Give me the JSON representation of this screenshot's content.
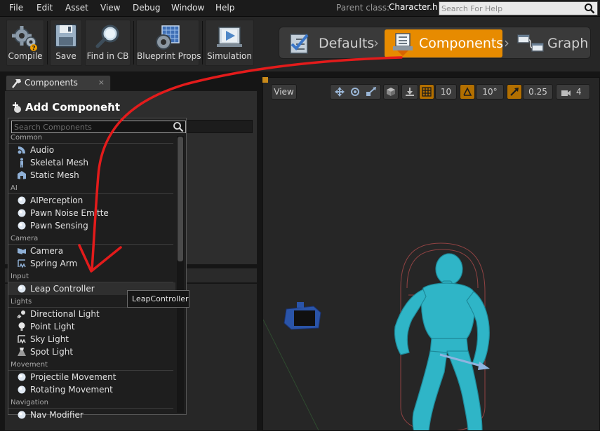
{
  "menu": [
    "File",
    "Edit",
    "Asset",
    "View",
    "Debug",
    "Window",
    "Help"
  ],
  "parent_class": {
    "label": "Parent class:",
    "value": "Character.h"
  },
  "help_search": {
    "placeholder": "Search For Help"
  },
  "toolbar": {
    "buttons": [
      {
        "label": "Compile",
        "icon": "compile-gears-icon"
      },
      {
        "label": "Save",
        "icon": "save-disk-icon"
      },
      {
        "label": "Find in CB",
        "icon": "magnifier-icon"
      },
      {
        "label": "Blueprint Props",
        "icon": "blueprint-props-icon"
      },
      {
        "label": "Simulation",
        "icon": "simulation-play-icon"
      }
    ],
    "modes": [
      {
        "label": "Defaults",
        "icon": "defaults-checklist-icon",
        "active": false
      },
      {
        "label": "Components",
        "icon": "components-icon",
        "active": true
      },
      {
        "label": "Graph",
        "icon": "graph-icon",
        "active": false
      }
    ],
    "mode_separator": "›"
  },
  "components_tab": {
    "label": "Components",
    "close": "×"
  },
  "add_component": {
    "label": "Add Component",
    "caret": "▾"
  },
  "component_search": {
    "placeholder": "Search Components"
  },
  "categories": [
    {
      "name": "Common",
      "items": [
        {
          "label": "Audio",
          "icon": "audio-icon"
        },
        {
          "label": "Skeletal Mesh",
          "icon": "skeletal-mesh-icon"
        },
        {
          "label": "Static Mesh",
          "icon": "static-mesh-icon"
        }
      ]
    },
    {
      "name": "AI",
      "items": [
        {
          "label": "AIPerception",
          "icon": "sphere-icon"
        },
        {
          "label": "Pawn Noise Emitte",
          "icon": "sphere-icon"
        },
        {
          "label": "Pawn Sensing",
          "icon": "sphere-icon"
        }
      ]
    },
    {
      "name": "Camera",
      "items": [
        {
          "label": "Camera",
          "icon": "camera-icon"
        },
        {
          "label": "Spring Arm",
          "icon": "spring-arm-icon"
        }
      ]
    },
    {
      "name": "Input",
      "items": [
        {
          "label": "Leap Controller",
          "icon": "sphere-icon",
          "hover": true
        }
      ]
    },
    {
      "name": "Lights",
      "items": [
        {
          "label": "Directional Light",
          "icon": "directional-light-icon"
        },
        {
          "label": "Point Light",
          "icon": "point-light-icon"
        },
        {
          "label": "Sky Light",
          "icon": "sky-light-icon"
        },
        {
          "label": "Spot Light",
          "icon": "spot-light-icon"
        }
      ]
    },
    {
      "name": "Movement",
      "items": [
        {
          "label": "Projectile Movement",
          "icon": "sphere-icon"
        },
        {
          "label": "Rotating Movement",
          "icon": "sphere-icon"
        }
      ]
    },
    {
      "name": "Navigation",
      "items": [
        {
          "label": "Nav Modifier",
          "icon": "sphere-icon"
        }
      ]
    }
  ],
  "tooltip": "LeapController",
  "viewport": {
    "view_button": "View",
    "grid_snap": "10",
    "rotation_snap": "10°",
    "scale_snap": "0.25",
    "camera_speed": "4"
  },
  "colors": {
    "accent_orange": "#e78b00",
    "annotation_red": "#e31b1b",
    "mannequin": "#2fb5c7"
  }
}
